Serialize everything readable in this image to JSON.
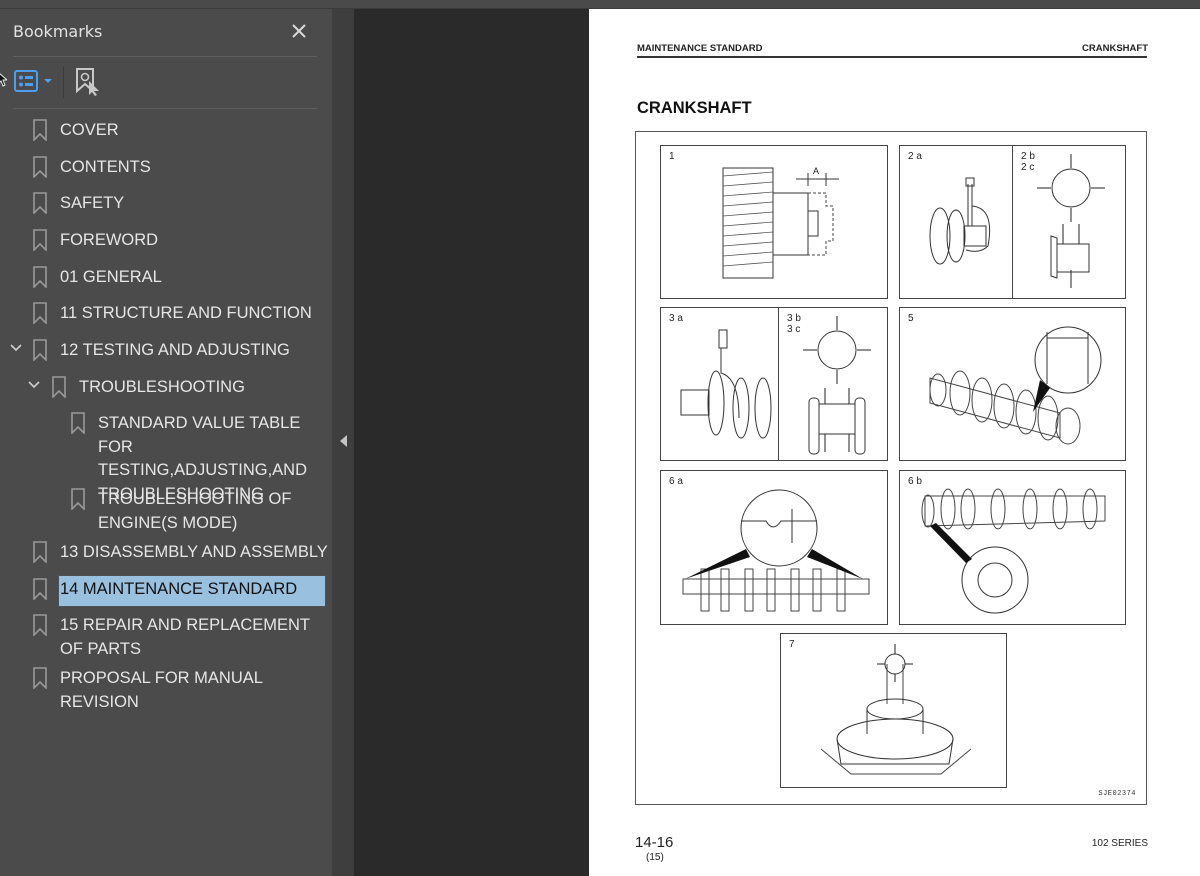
{
  "sidebar": {
    "title": "Bookmarks",
    "close_icon": "close-icon",
    "toolbar": {
      "options_icon": "bookmark-list-options-icon",
      "find_icon": "find-current-bookmark-icon"
    },
    "bookmarks": [
      {
        "label": "COVER",
        "level": 0,
        "expandable": false
      },
      {
        "label": "CONTENTS",
        "level": 0,
        "expandable": false
      },
      {
        "label": "SAFETY",
        "level": 0,
        "expandable": false
      },
      {
        "label": "FOREWORD",
        "level": 0,
        "expandable": false
      },
      {
        "label": "01 GENERAL",
        "level": 0,
        "expandable": false
      },
      {
        "label": "11 STRUCTURE AND FUNCTION",
        "level": 0,
        "expandable": false
      },
      {
        "label": "12 TESTING AND ADJUSTING",
        "level": 0,
        "expandable": true,
        "expanded": true
      },
      {
        "label": "TROUBLESHOOTING",
        "level": 1,
        "expandable": true,
        "expanded": true
      },
      {
        "label": "STANDARD VALUE TABLE FOR TESTING,ADJUSTING,AND TROUBLESHOOTING",
        "level": 2,
        "expandable": false
      },
      {
        "label": "TROUBLESHOOTING OF ENGINE(S MODE)",
        "level": 2,
        "expandable": false
      },
      {
        "label": "13 DISASSEMBLY AND ASSEMBLY",
        "level": 0,
        "expandable": false
      },
      {
        "label": "14 MAINTENANCE STANDARD",
        "level": 0,
        "expandable": false,
        "selected": true
      },
      {
        "label": "15 REPAIR AND REPLACEMENT OF PARTS",
        "level": 0,
        "expandable": false
      },
      {
        "label": "PROPOSAL FOR MANUAL REVISION",
        "level": 0,
        "expandable": false
      }
    ],
    "selection_color": "#99c0de"
  },
  "page": {
    "header_left": "MAINTENANCE STANDARD",
    "header_right": "CRANKSHAFT",
    "title": "CRANKSHAFT",
    "figure": {
      "code": "SJE02374",
      "panels": [
        {
          "id": "1",
          "label": "1",
          "dimension": "A"
        },
        {
          "id": "2a",
          "label": "2 a"
        },
        {
          "id": "2bc",
          "label": "2 b\n2 c"
        },
        {
          "id": "3a",
          "label": "3 a"
        },
        {
          "id": "3bc",
          "label": "3 b\n3 c"
        },
        {
          "id": "5",
          "label": "5"
        },
        {
          "id": "6a",
          "label": "6 a"
        },
        {
          "id": "6b",
          "label": "6 b"
        },
        {
          "id": "7",
          "label": "7"
        }
      ]
    },
    "page_number": "14-16",
    "page_sub": "(15)",
    "series": "102 SERIES"
  }
}
